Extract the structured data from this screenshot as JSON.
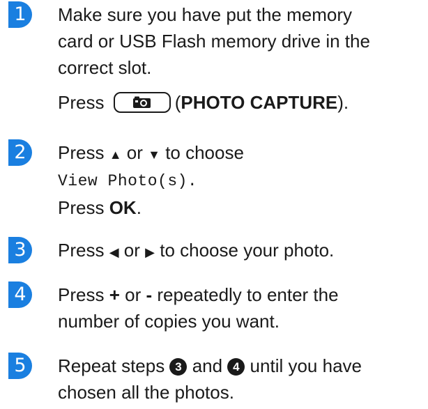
{
  "steps": [
    {
      "number": "1",
      "line1": "Make sure you have put the memory",
      "line2": "card or USB Flash memory drive in the",
      "line3": "correct slot.",
      "press": "Press",
      "button_open": "(",
      "button_name": "PHOTO CAPTURE",
      "button_close": ")."
    },
    {
      "number": "2",
      "press": "Press",
      "up_arrow": "▲",
      "or": "or",
      "down_arrow": "▼",
      "to_choose": "to choose",
      "menu_item": "View Photo(s).",
      "press2": "Press",
      "ok": "OK",
      "period": "."
    },
    {
      "number": "3",
      "press": "Press",
      "left_arrow": "◀",
      "or": "or",
      "right_arrow": "▶",
      "rest": "to choose your photo."
    },
    {
      "number": "4",
      "press": "Press",
      "plus": "+",
      "or": "or",
      "minus": "-",
      "rest_line1": "repeatedly to enter the",
      "line2": "number of copies you want."
    },
    {
      "number": "5",
      "repeat": "Repeat steps",
      "ref_a": "3",
      "and": "and",
      "ref_b": "4",
      "until": "until you have",
      "line2": "chosen all the photos."
    }
  ],
  "icons": {
    "step_marker_color": "#1a7fe0",
    "photo_button_icon": "camera-icon"
  }
}
